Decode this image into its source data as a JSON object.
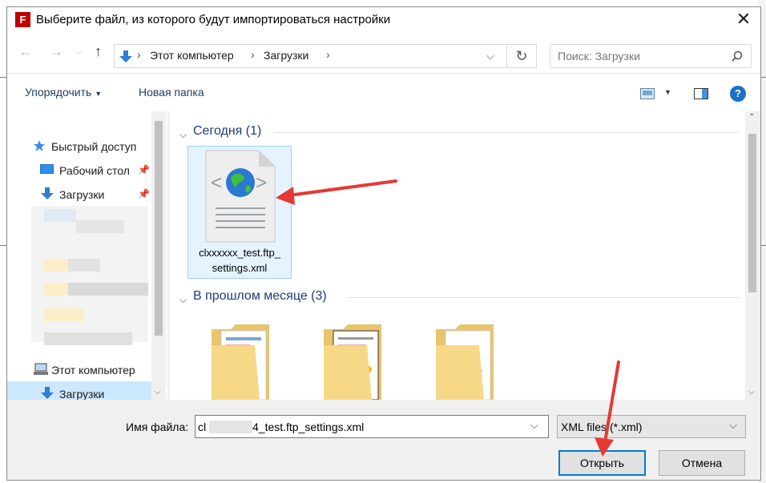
{
  "window": {
    "title": "Выберите файл, из которого будут импортироваться настройки",
    "app_icon_letter": "F"
  },
  "nav": {
    "breadcrumb": [
      "Этот компьютер",
      "Загрузки"
    ],
    "search_placeholder": "Поиск: Загрузки"
  },
  "toolbar": {
    "organize": "Упорядочить",
    "new_folder": "Новая папка",
    "help": "?"
  },
  "navpane": {
    "quick_access": "Быстрый доступ",
    "items": [
      "Рабочий стол",
      "Загрузки"
    ],
    "this_pc": "Этот компьютер",
    "downloads": "Загрузки"
  },
  "content": {
    "group_today": "Сегодня (1)",
    "group_last_month": "В прошлом месяце (3)",
    "file_name_line1": "clxxxxxx_test.ftp_",
    "file_name_line2": "settings.xml"
  },
  "bottom": {
    "filename_label": "Имя файла:",
    "filename_prefix": "cl",
    "filename_suffix": "4_test.ftp_settings.xml",
    "filetype": "XML files (*.xml)",
    "open": "Открыть",
    "cancel": "Отмена"
  },
  "colors": {
    "accent": "#0078d7",
    "annotation": "#e53935",
    "group_text": "#1e3b7e"
  }
}
